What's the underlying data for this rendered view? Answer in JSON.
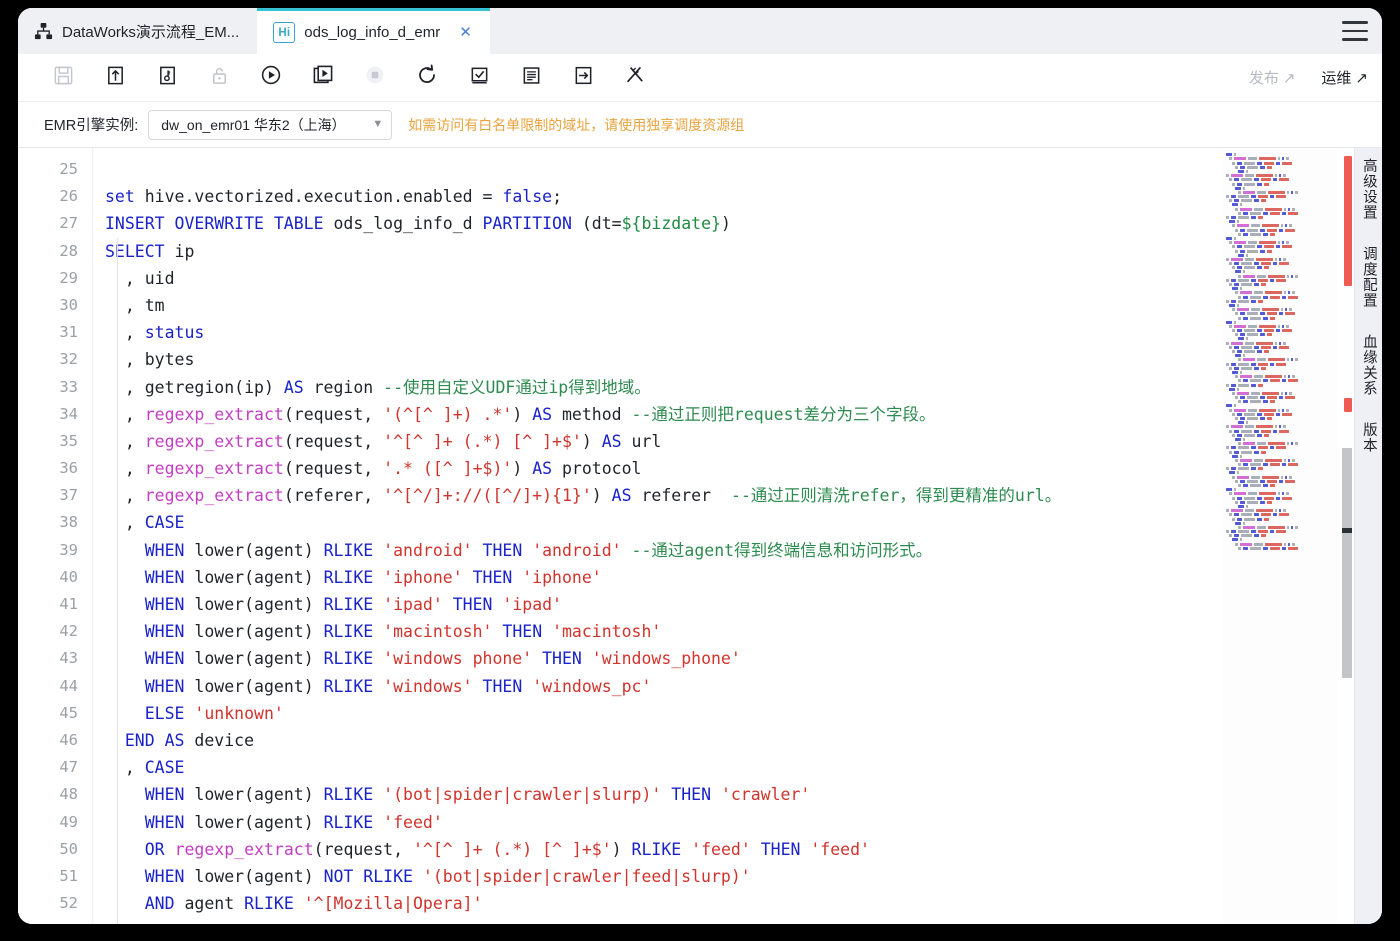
{
  "window": {
    "tabs": [
      {
        "label": "DataWorks演示流程_EM...",
        "icon": "sitemap-icon",
        "active": false,
        "closable": false
      },
      {
        "label": "ods_log_info_d_emr",
        "icon": "hive-badge-icon",
        "badge": "Hi",
        "active": true,
        "closable": true
      }
    ],
    "menu_icon": "hamburger-menu-icon"
  },
  "toolbar": {
    "buttons": [
      {
        "name": "save-button",
        "icon": "floppy-save-icon",
        "disabled": true
      },
      {
        "name": "submit-button",
        "icon": "upload-arrow-icon",
        "disabled": false
      },
      {
        "name": "steal-lock-button",
        "icon": "key-page-icon",
        "disabled": false
      },
      {
        "name": "lock-button",
        "icon": "lock-open-icon",
        "disabled": true
      },
      {
        "name": "run-button",
        "icon": "play-circle-icon",
        "disabled": false
      },
      {
        "name": "run-smoke-button",
        "icon": "play-pages-icon",
        "disabled": false
      },
      {
        "name": "stop-button",
        "icon": "stop-circle-icon",
        "disabled": true
      },
      {
        "name": "rerun-button",
        "icon": "refresh-icon",
        "disabled": false
      },
      {
        "name": "precheck-button",
        "icon": "check-square-icon",
        "disabled": false
      },
      {
        "name": "format-button",
        "icon": "lines-doc-icon",
        "disabled": false
      },
      {
        "name": "param-button",
        "icon": "arrow-in-box-icon",
        "disabled": false
      },
      {
        "name": "tools-button",
        "icon": "pencil-cross-icon",
        "disabled": false
      }
    ],
    "publish_label": "发布",
    "publish_icon": "external-link-icon",
    "ops_label": "运维",
    "ops_icon": "external-link-icon"
  },
  "engine_bar": {
    "label": "EMR引擎实例:",
    "select_value": "dw_on_emr01 华东2（上海）",
    "select_icon": "chevron-down-icon",
    "note": "如需访问有白名单限制的域址，请使用独享调度资源组",
    "note_color": "#e8a33d"
  },
  "editor": {
    "first_line_number": 25,
    "lines": [
      {
        "n": 25,
        "tokens": []
      },
      {
        "n": 26,
        "tokens": [
          {
            "t": "set ",
            "c": "k"
          },
          {
            "t": "hive.vectorized.execution.enabled ",
            "c": "op"
          },
          {
            "t": "= ",
            "c": "op"
          },
          {
            "t": "false",
            "c": "k"
          },
          {
            "t": ";",
            "c": "op"
          }
        ]
      },
      {
        "n": 27,
        "tokens": [
          {
            "t": "INSERT OVERWRITE TABLE ",
            "c": "k"
          },
          {
            "t": "ods_log_info_d ",
            "c": "op"
          },
          {
            "t": "PARTITION ",
            "c": "k"
          },
          {
            "t": "(dt=",
            "c": "op"
          },
          {
            "t": "${bizdate}",
            "c": "num"
          },
          {
            "t": ")",
            "c": "op"
          }
        ]
      },
      {
        "n": 28,
        "tokens": [
          {
            "t": "SELECT ",
            "c": "k"
          },
          {
            "t": "ip",
            "c": "op"
          }
        ]
      },
      {
        "n": 29,
        "tokens": [
          {
            "t": "  , uid",
            "c": "op"
          }
        ]
      },
      {
        "n": 30,
        "tokens": [
          {
            "t": "  , tm",
            "c": "op"
          }
        ]
      },
      {
        "n": 31,
        "tokens": [
          {
            "t": "  , ",
            "c": "op"
          },
          {
            "t": "status",
            "c": "k"
          }
        ]
      },
      {
        "n": 32,
        "tokens": [
          {
            "t": "  , bytes",
            "c": "op"
          }
        ]
      },
      {
        "n": 33,
        "tokens": [
          {
            "t": "  , getregion(ip) ",
            "c": "op"
          },
          {
            "t": "AS ",
            "c": "k"
          },
          {
            "t": "region ",
            "c": "op"
          },
          {
            "t": "--使用自定义UDF通过ip得到地域。",
            "c": "cm"
          }
        ]
      },
      {
        "n": 34,
        "tokens": [
          {
            "t": "  , ",
            "c": "op"
          },
          {
            "t": "regexp_extract",
            "c": "fn"
          },
          {
            "t": "(request, ",
            "c": "op"
          },
          {
            "t": "'(^[^ ]+) .*'",
            "c": "s"
          },
          {
            "t": ") ",
            "c": "op"
          },
          {
            "t": "AS ",
            "c": "k"
          },
          {
            "t": "method ",
            "c": "op"
          },
          {
            "t": "--通过正则把request差分为三个字段。",
            "c": "cm"
          }
        ]
      },
      {
        "n": 35,
        "tokens": [
          {
            "t": "  , ",
            "c": "op"
          },
          {
            "t": "regexp_extract",
            "c": "fn"
          },
          {
            "t": "(request, ",
            "c": "op"
          },
          {
            "t": "'^[^ ]+ (.*) [^ ]+$'",
            "c": "s"
          },
          {
            "t": ") ",
            "c": "op"
          },
          {
            "t": "AS ",
            "c": "k"
          },
          {
            "t": "url",
            "c": "op"
          }
        ]
      },
      {
        "n": 36,
        "tokens": [
          {
            "t": "  , ",
            "c": "op"
          },
          {
            "t": "regexp_extract",
            "c": "fn"
          },
          {
            "t": "(request, ",
            "c": "op"
          },
          {
            "t": "'.* ([^ ]+$)'",
            "c": "s"
          },
          {
            "t": ") ",
            "c": "op"
          },
          {
            "t": "AS ",
            "c": "k"
          },
          {
            "t": "protocol",
            "c": "op"
          }
        ]
      },
      {
        "n": 37,
        "tokens": [
          {
            "t": "  , ",
            "c": "op"
          },
          {
            "t": "regexp_extract",
            "c": "fn"
          },
          {
            "t": "(referer, ",
            "c": "op"
          },
          {
            "t": "'^[^/]+://([^/]+){1}'",
            "c": "s"
          },
          {
            "t": ") ",
            "c": "op"
          },
          {
            "t": "AS ",
            "c": "k"
          },
          {
            "t": "referer  ",
            "c": "op"
          },
          {
            "t": "--通过正则清洗refer，得到更精准的url。",
            "c": "cm"
          }
        ]
      },
      {
        "n": 38,
        "tokens": [
          {
            "t": "  , ",
            "c": "op"
          },
          {
            "t": "CASE",
            "c": "k"
          }
        ]
      },
      {
        "n": 39,
        "tokens": [
          {
            "t": "    ",
            "c": "op"
          },
          {
            "t": "WHEN ",
            "c": "k"
          },
          {
            "t": "lower(agent) ",
            "c": "op"
          },
          {
            "t": "RLIKE ",
            "c": "k"
          },
          {
            "t": "'android' ",
            "c": "s"
          },
          {
            "t": "THEN ",
            "c": "k"
          },
          {
            "t": "'android' ",
            "c": "s"
          },
          {
            "t": "--通过agent得到终端信息和访问形式。",
            "c": "cm"
          }
        ]
      },
      {
        "n": 40,
        "tokens": [
          {
            "t": "    ",
            "c": "op"
          },
          {
            "t": "WHEN ",
            "c": "k"
          },
          {
            "t": "lower(agent) ",
            "c": "op"
          },
          {
            "t": "RLIKE ",
            "c": "k"
          },
          {
            "t": "'iphone' ",
            "c": "s"
          },
          {
            "t": "THEN ",
            "c": "k"
          },
          {
            "t": "'iphone'",
            "c": "s"
          }
        ]
      },
      {
        "n": 41,
        "tokens": [
          {
            "t": "    ",
            "c": "op"
          },
          {
            "t": "WHEN ",
            "c": "k"
          },
          {
            "t": "lower(agent) ",
            "c": "op"
          },
          {
            "t": "RLIKE ",
            "c": "k"
          },
          {
            "t": "'ipad' ",
            "c": "s"
          },
          {
            "t": "THEN ",
            "c": "k"
          },
          {
            "t": "'ipad'",
            "c": "s"
          }
        ]
      },
      {
        "n": 42,
        "tokens": [
          {
            "t": "    ",
            "c": "op"
          },
          {
            "t": "WHEN ",
            "c": "k"
          },
          {
            "t": "lower(agent) ",
            "c": "op"
          },
          {
            "t": "RLIKE ",
            "c": "k"
          },
          {
            "t": "'macintosh' ",
            "c": "s"
          },
          {
            "t": "THEN ",
            "c": "k"
          },
          {
            "t": "'macintosh'",
            "c": "s"
          }
        ]
      },
      {
        "n": 43,
        "tokens": [
          {
            "t": "    ",
            "c": "op"
          },
          {
            "t": "WHEN ",
            "c": "k"
          },
          {
            "t": "lower(agent) ",
            "c": "op"
          },
          {
            "t": "RLIKE ",
            "c": "k"
          },
          {
            "t": "'windows phone' ",
            "c": "s"
          },
          {
            "t": "THEN ",
            "c": "k"
          },
          {
            "t": "'windows_phone'",
            "c": "s"
          }
        ]
      },
      {
        "n": 44,
        "tokens": [
          {
            "t": "    ",
            "c": "op"
          },
          {
            "t": "WHEN ",
            "c": "k"
          },
          {
            "t": "lower(agent) ",
            "c": "op"
          },
          {
            "t": "RLIKE ",
            "c": "k"
          },
          {
            "t": "'windows' ",
            "c": "s"
          },
          {
            "t": "THEN ",
            "c": "k"
          },
          {
            "t": "'windows_pc'",
            "c": "s"
          }
        ]
      },
      {
        "n": 45,
        "tokens": [
          {
            "t": "    ",
            "c": "op"
          },
          {
            "t": "ELSE ",
            "c": "k"
          },
          {
            "t": "'unknown'",
            "c": "s"
          }
        ]
      },
      {
        "n": 46,
        "tokens": [
          {
            "t": "  ",
            "c": "op"
          },
          {
            "t": "END AS ",
            "c": "k"
          },
          {
            "t": "device",
            "c": "op"
          }
        ]
      },
      {
        "n": 47,
        "tokens": [
          {
            "t": "  , ",
            "c": "op"
          },
          {
            "t": "CASE",
            "c": "k"
          }
        ]
      },
      {
        "n": 48,
        "tokens": [
          {
            "t": "    ",
            "c": "op"
          },
          {
            "t": "WHEN ",
            "c": "k"
          },
          {
            "t": "lower(agent) ",
            "c": "op"
          },
          {
            "t": "RLIKE ",
            "c": "k"
          },
          {
            "t": "'(bot|spider|crawler|slurp)' ",
            "c": "s"
          },
          {
            "t": "THEN ",
            "c": "k"
          },
          {
            "t": "'crawler'",
            "c": "s"
          }
        ]
      },
      {
        "n": 49,
        "tokens": [
          {
            "t": "    ",
            "c": "op"
          },
          {
            "t": "WHEN ",
            "c": "k"
          },
          {
            "t": "lower(agent) ",
            "c": "op"
          },
          {
            "t": "RLIKE ",
            "c": "k"
          },
          {
            "t": "'feed'",
            "c": "s"
          }
        ]
      },
      {
        "n": 50,
        "tokens": [
          {
            "t": "    ",
            "c": "op"
          },
          {
            "t": "OR ",
            "c": "k"
          },
          {
            "t": "regexp_extract",
            "c": "fn"
          },
          {
            "t": "(request, ",
            "c": "op"
          },
          {
            "t": "'^[^ ]+ (.*) [^ ]+$'",
            "c": "s"
          },
          {
            "t": ") ",
            "c": "op"
          },
          {
            "t": "RLIKE ",
            "c": "k"
          },
          {
            "t": "'feed' ",
            "c": "s"
          },
          {
            "t": "THEN ",
            "c": "k"
          },
          {
            "t": "'feed'",
            "c": "s"
          }
        ]
      },
      {
        "n": 51,
        "tokens": [
          {
            "t": "    ",
            "c": "op"
          },
          {
            "t": "WHEN ",
            "c": "k"
          },
          {
            "t": "lower(agent) ",
            "c": "op"
          },
          {
            "t": "NOT RLIKE ",
            "c": "k"
          },
          {
            "t": "'(bot|spider|crawler|feed|slurp)'",
            "c": "s"
          }
        ]
      },
      {
        "n": 52,
        "tokens": [
          {
            "t": "    ",
            "c": "op"
          },
          {
            "t": "AND ",
            "c": "k"
          },
          {
            "t": "agent ",
            "c": "op"
          },
          {
            "t": "RLIKE ",
            "c": "k"
          },
          {
            "t": "'^[Mozilla|Opera]'",
            "c": "s"
          }
        ]
      }
    ],
    "colors": {
      "keyword": "#1a23c8",
      "function": "#c43ec3",
      "string": "#d0342c",
      "comment": "#2e8b4f",
      "variable": "#1f8a42",
      "text": "#1f2329",
      "line_number": "#9aa0a6"
    }
  },
  "right_rail": {
    "items": [
      {
        "label": "高级设置",
        "name": "rail-advanced-settings"
      },
      {
        "label": "调度配置",
        "name": "rail-schedule-config"
      },
      {
        "label": "血缘关系",
        "name": "rail-lineage"
      },
      {
        "label": "版本",
        "name": "rail-version"
      }
    ]
  }
}
